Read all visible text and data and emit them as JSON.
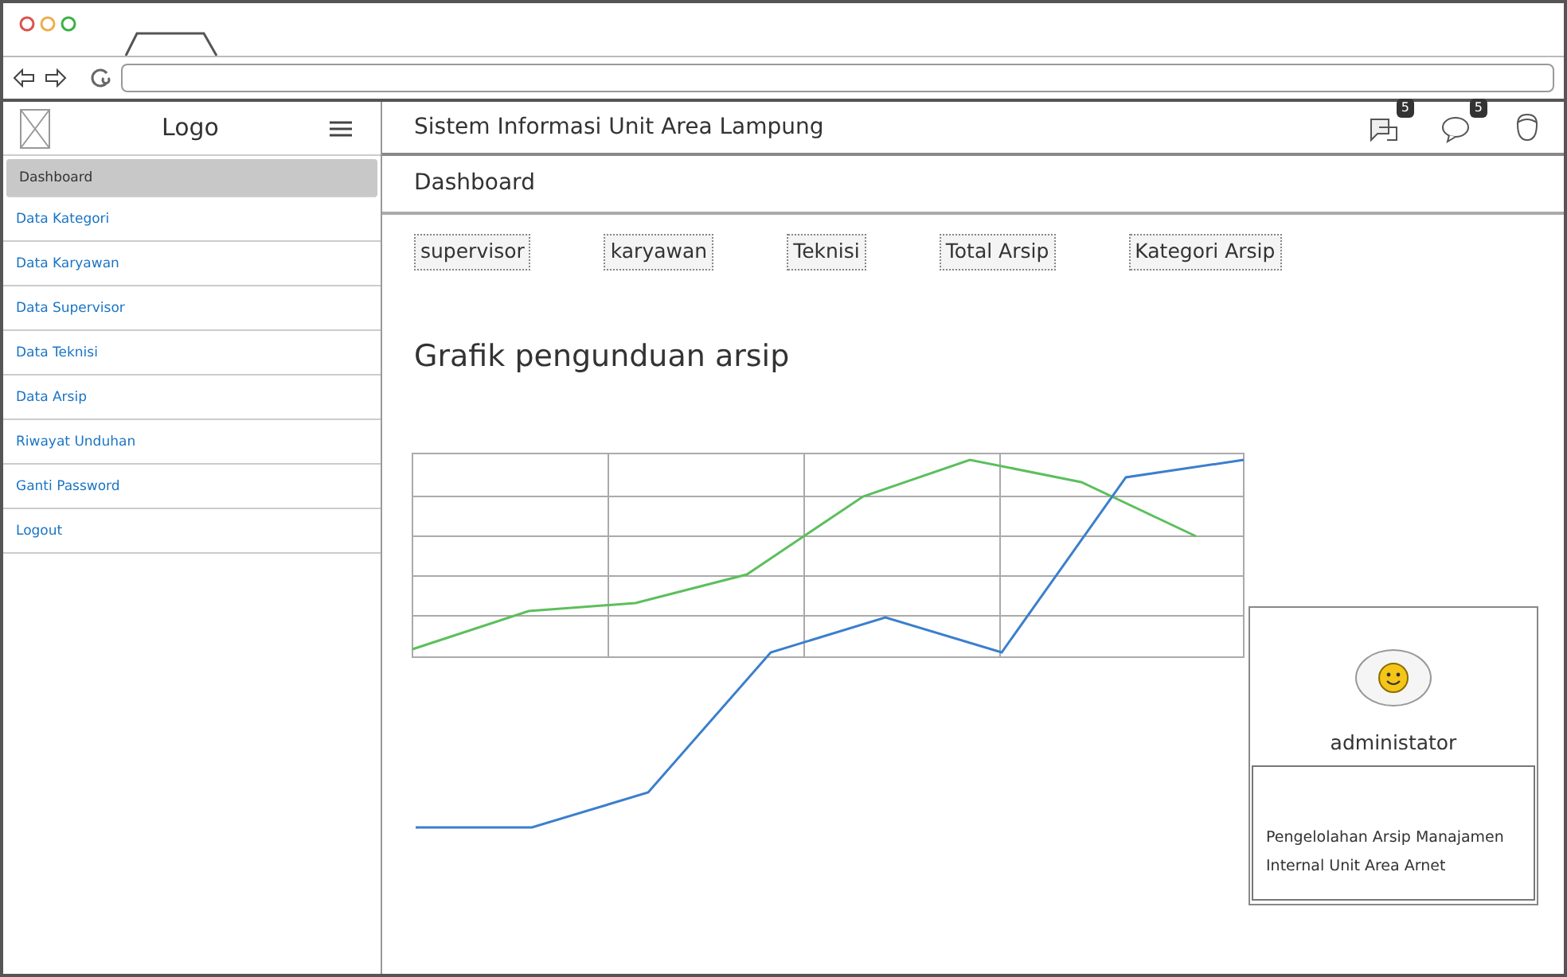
{
  "sidebar": {
    "logo": "Logo",
    "items": [
      {
        "label": "Dashboard",
        "selected": true
      },
      {
        "label": "Data Kategori",
        "selected": false
      },
      {
        "label": "Data Karyawan",
        "selected": false
      },
      {
        "label": "Data Supervisor",
        "selected": false
      },
      {
        "label": "Data Teknisi",
        "selected": false
      },
      {
        "label": "Data Arsip",
        "selected": false
      },
      {
        "label": "Riwayat Unduhan",
        "selected": false
      },
      {
        "label": "Ganti Password",
        "selected": false
      },
      {
        "label": "Logout",
        "selected": false
      }
    ]
  },
  "header": {
    "title": "Sistem Informasi Unit Area Lampung",
    "notifications": [
      {
        "kind": "messages",
        "count": "5"
      },
      {
        "kind": "chat",
        "count": "5"
      }
    ]
  },
  "breadcrumb": "Dashboard",
  "stats": [
    "supervisor",
    "karyawan",
    "Teknisi",
    "Total Arsip",
    "Kategori Arsip"
  ],
  "chart": {
    "title": "Grafik pengunduan arsip"
  },
  "profile_card": {
    "name": "administator",
    "description": "Pengelolahan Arsip Manajamen Internal Unit Area Arnet"
  }
}
